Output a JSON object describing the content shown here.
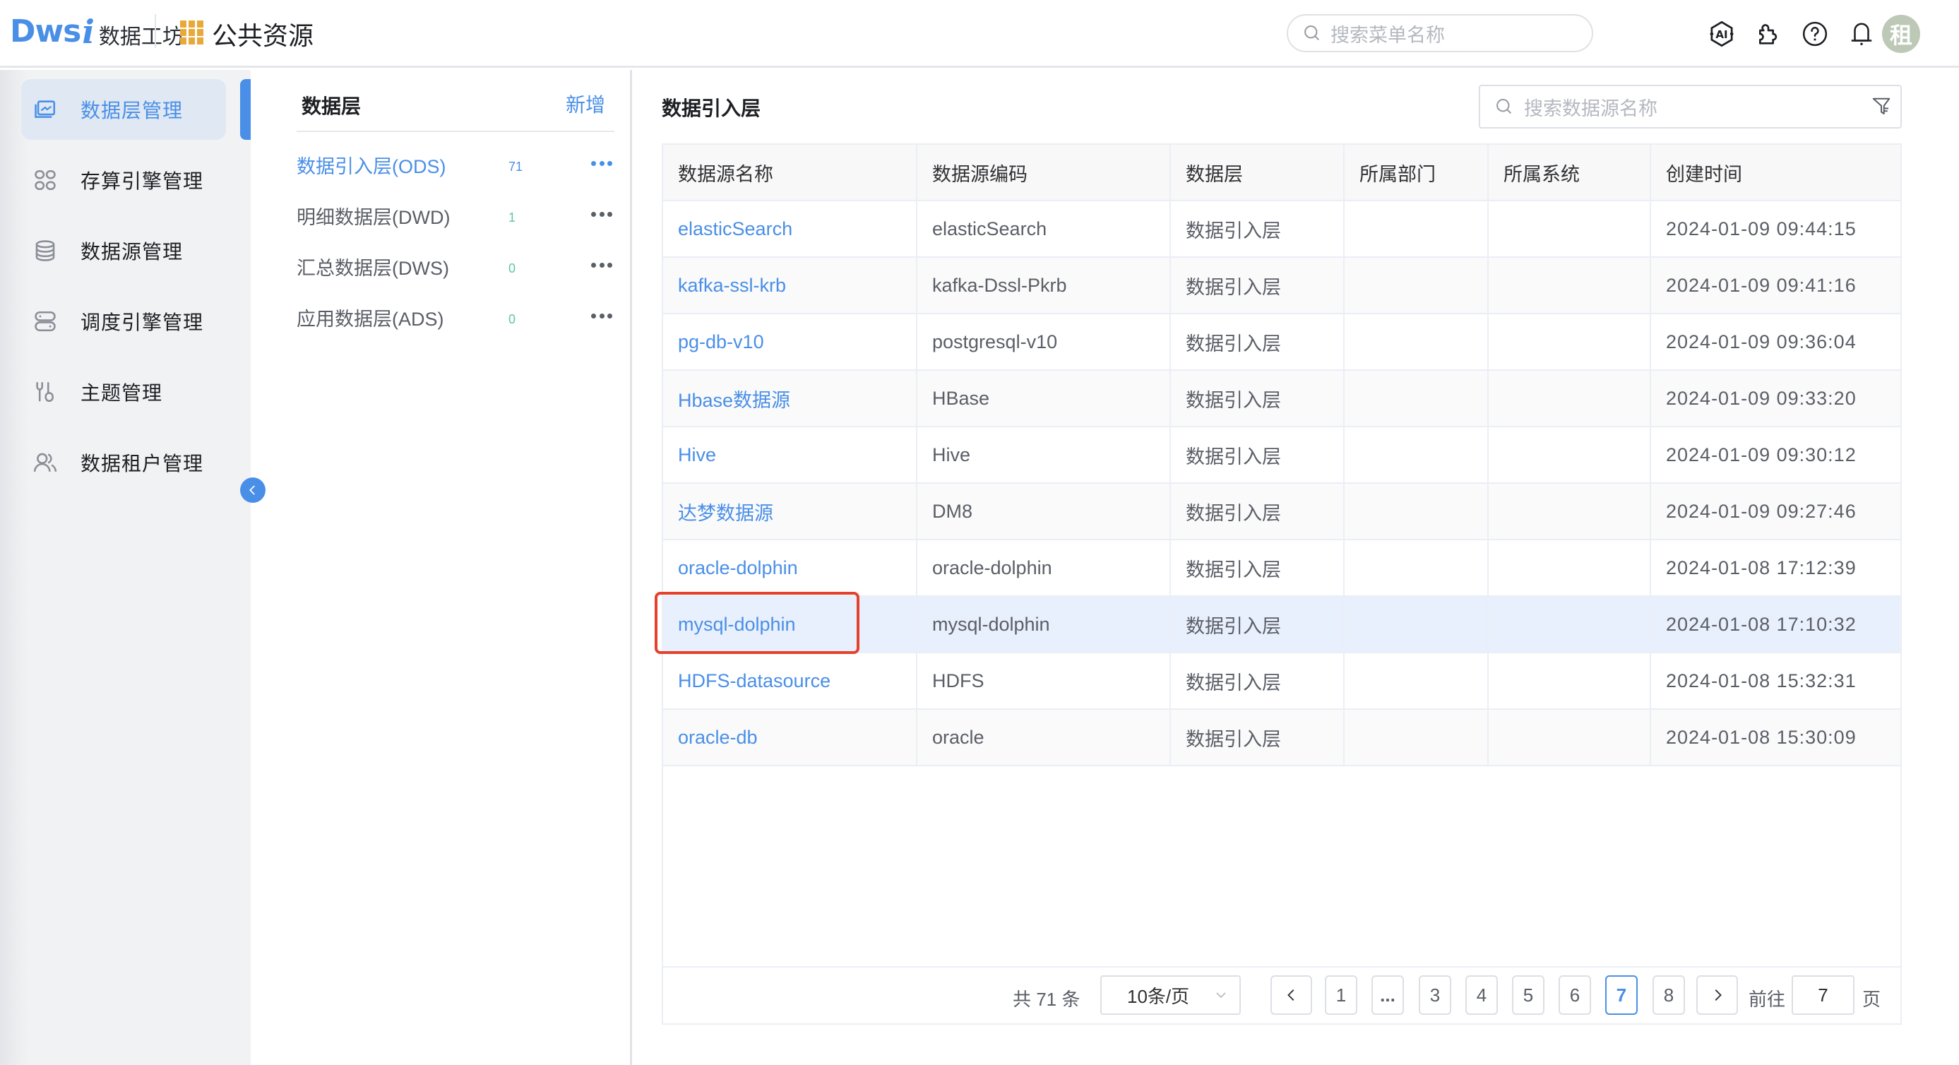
{
  "header": {
    "logo_mark": "Dws",
    "logo_i": "i",
    "logo_text": "数据工坊",
    "app_title": "公共资源",
    "menu_search_placeholder": "搜索菜单名称",
    "icons": [
      "ai-icon",
      "plugin-icon",
      "help-icon",
      "bell-icon"
    ],
    "avatar_text": "租"
  },
  "sidebar": {
    "items": [
      {
        "label": "数据层管理",
        "icon": "data-layer-icon",
        "active": true
      },
      {
        "label": "存算引擎管理",
        "icon": "compute-engine-icon",
        "active": false
      },
      {
        "label": "数据源管理",
        "icon": "database-icon",
        "active": false
      },
      {
        "label": "调度引擎管理",
        "icon": "scheduler-icon",
        "active": false
      },
      {
        "label": "主题管理",
        "icon": "tools-icon",
        "active": false
      },
      {
        "label": "数据租户管理",
        "icon": "users-icon",
        "active": false
      }
    ],
    "collapse_icon": "chevron-left-icon"
  },
  "layers": {
    "title": "数据层",
    "add_label": "新增",
    "items": [
      {
        "name": "数据引入层(ODS)",
        "count": "71",
        "active": true
      },
      {
        "name": "明细数据层(DWD)",
        "count": "1",
        "active": false
      },
      {
        "name": "汇总数据层(DWS)",
        "count": "0",
        "active": false
      },
      {
        "name": "应用数据层(ADS)",
        "count": "0",
        "active": false
      }
    ]
  },
  "main": {
    "title": "数据引入层",
    "search_placeholder": "搜索数据源名称",
    "columns": [
      "数据源名称",
      "数据源编码",
      "数据层",
      "所属部门",
      "所属系统",
      "创建时间"
    ],
    "rows": [
      [
        "elasticSearch",
        "elasticSearch",
        "数据引入层",
        "",
        "",
        "2024-01-09 09:44:15"
      ],
      [
        "kafka-ssl-krb",
        "kafka-Dssl-Pkrb",
        "数据引入层",
        "",
        "",
        "2024-01-09 09:41:16"
      ],
      [
        "pg-db-v10",
        "postgresql-v10",
        "数据引入层",
        "",
        "",
        "2024-01-09 09:36:04"
      ],
      [
        "Hbase数据源",
        "HBase",
        "数据引入层",
        "",
        "",
        "2024-01-09 09:33:20"
      ],
      [
        "Hive",
        "Hive",
        "数据引入层",
        "",
        "",
        "2024-01-09 09:30:12"
      ],
      [
        "达梦数据源",
        "DM8",
        "数据引入层",
        "",
        "",
        "2024-01-09 09:27:46"
      ],
      [
        "oracle-dolphin",
        "oracle-dolphin",
        "数据引入层",
        "",
        "",
        "2024-01-08 17:12:39"
      ],
      [
        "mysql-dolphin",
        "mysql-dolphin",
        "数据引入层",
        "",
        "",
        "2024-01-08 17:10:32"
      ],
      [
        "HDFS-datasource",
        "HDFS",
        "数据引入层",
        "",
        "",
        "2024-01-08 15:32:31"
      ],
      [
        "oracle-db",
        "oracle",
        "数据引入层",
        "",
        "",
        "2024-01-08 15:30:09"
      ]
    ],
    "hovered_row": 7,
    "highlighted_cell": "mysql-dolphin"
  },
  "pagination": {
    "total_label": "共 71 条",
    "page_size": "10条/页",
    "prev_icon": "chevron-left-icon",
    "next_icon": "chevron-right-icon",
    "pages": [
      "1",
      "...",
      "3",
      "4",
      "5",
      "6",
      "7",
      "8"
    ],
    "current_page": "7",
    "goto_label": "前往",
    "goto_value": "7",
    "page_suffix": "页"
  },
  "colors": {
    "accent": "#4a8fe7",
    "count_green": "#5cc7a0",
    "highlight_red": "#e5412d",
    "hover_row": "#e9f0fd",
    "app_grid": "#e8a93a",
    "avatar_bg": "#bdc8b6"
  }
}
